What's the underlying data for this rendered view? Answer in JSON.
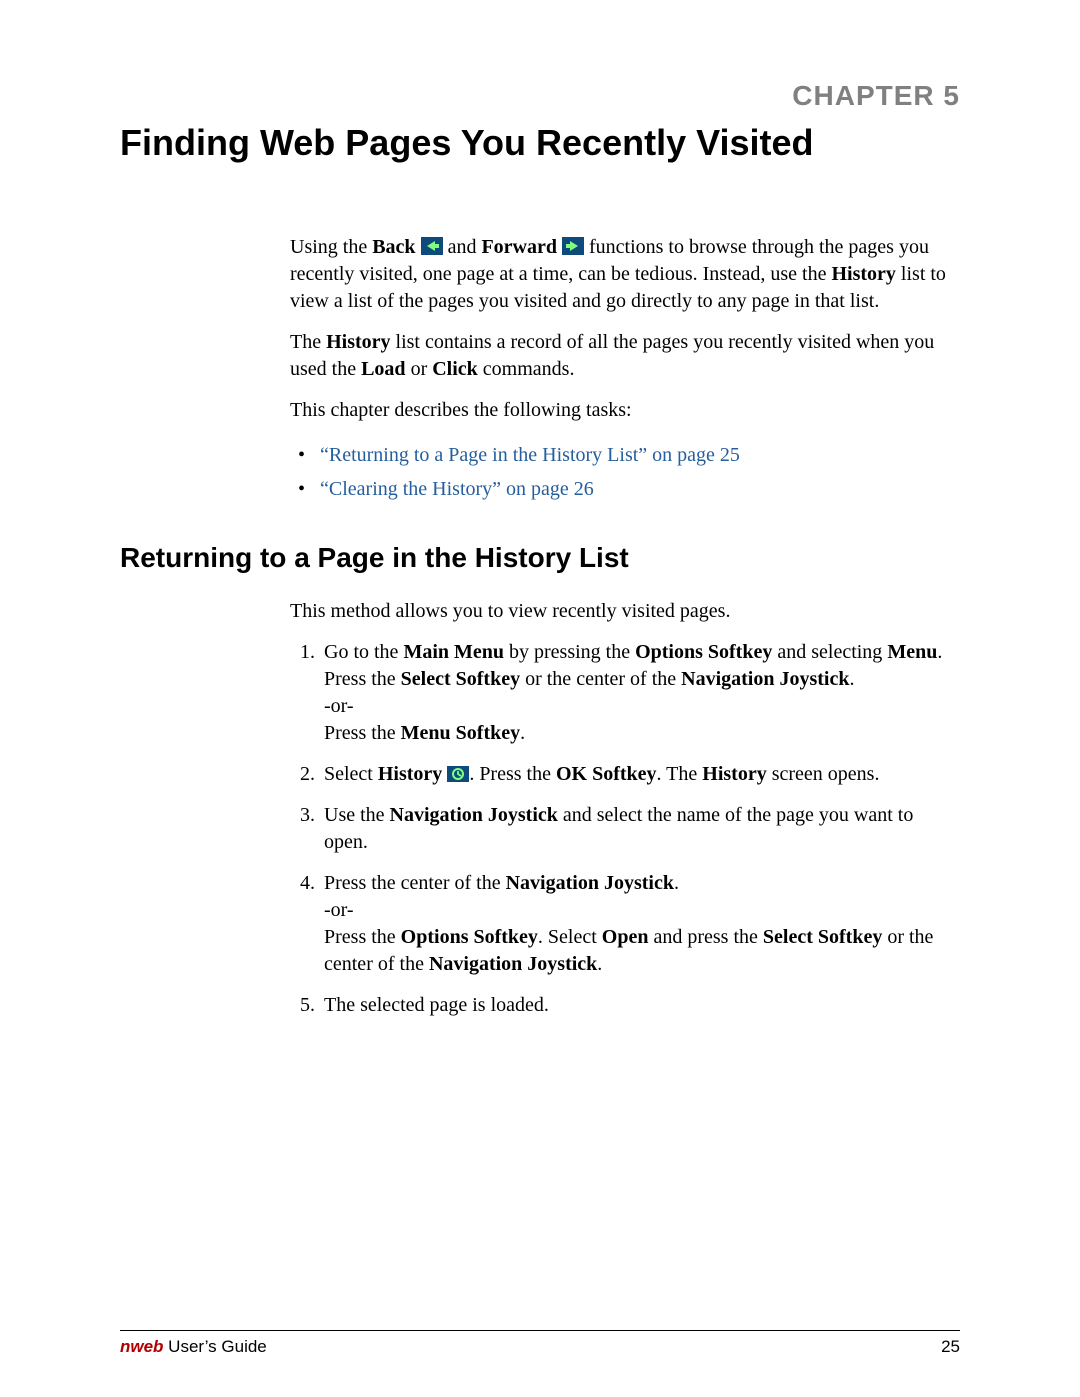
{
  "chapter_label": "CHAPTER 5",
  "chapter_title": "Finding Web Pages You Recently Visited",
  "intro": {
    "p1_seg1": "Using the ",
    "p1_b1": "Back",
    "p1_seg2": " ",
    "p1_seg3": " and ",
    "p1_b2": "Forward",
    "p1_seg4": " ",
    "p1_seg5": " functions to browse through the pages you recently visited, one page at a time, can be tedious. Instead, use the ",
    "p1_b3": "History",
    "p1_seg6": " list to view a list of the pages you visited and go directly to any page in that list.",
    "p2_seg1": "The ",
    "p2_b1": "History",
    "p2_seg2": " list contains a record of all the pages you recently visited when you used the ",
    "p2_b2": "Load",
    "p2_seg3": " or ",
    "p2_b3": "Click",
    "p2_seg4": " commands.",
    "p3": "This chapter describes the following tasks:"
  },
  "links": {
    "l1": "“Returning to a Page in the History List” on page 25",
    "l2": "“Clearing the History” on page 26"
  },
  "section": {
    "heading": "Returning to a Page in the History List",
    "intro": "This method allows you to view recently visited pages."
  },
  "steps": {
    "s1_seg1": "Go to the ",
    "s1_b1": "Main Menu",
    "s1_seg2": " by pressing the ",
    "s1_b2": "Options Softkey",
    "s1_seg3": " and selecting ",
    "s1_b3": "Menu",
    "s1_seg4": ". Press the ",
    "s1_b4": "Select Softkey",
    "s1_seg5": " or the center of the ",
    "s1_b5": "Navigation Joystick",
    "s1_seg6": ".",
    "s1_or": "-or-",
    "s1_seg7": "Press the ",
    "s1_b6": "Menu Softkey",
    "s1_seg8": ".",
    "s2_seg1": "Select ",
    "s2_b1": "History",
    "s2_seg2": " ",
    "s2_seg3": ". Press the ",
    "s2_b2": "OK Softkey",
    "s2_seg4": ". The ",
    "s2_b3": "History",
    "s2_seg5": " screen opens.",
    "s3_seg1": "Use the ",
    "s3_b1": "Navigation Joystick",
    "s3_seg2": " and select the name of the page you want to open.",
    "s4_seg1": "Press the center of the ",
    "s4_b1": "Navigation Joystick",
    "s4_seg2": ".",
    "s4_or": "-or-",
    "s4_seg3": "Press the ",
    "s4_b2": "Options Softkey",
    "s4_seg4": ". Select ",
    "s4_b3": "Open",
    "s4_seg5": " and press the ",
    "s4_b4": "Select Softkey",
    "s4_seg6": " or the center of the ",
    "s4_b5": "Navigation Joystick",
    "s4_seg7": ".",
    "s5": "The selected page is loaded."
  },
  "footer": {
    "brand": "nweb",
    "rest": " User’s Guide",
    "page": "25"
  }
}
